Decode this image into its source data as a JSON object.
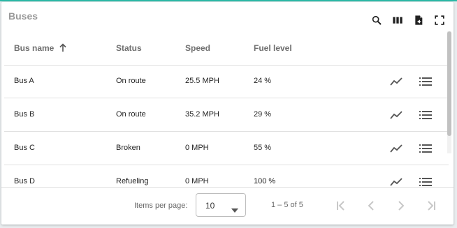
{
  "table": {
    "title": "Buses",
    "columns": {
      "bus_name": "Bus name",
      "status": "Status",
      "speed": "Speed",
      "fuel": "Fuel level"
    },
    "rows": [
      {
        "name": "Bus A",
        "status": "On route",
        "speed": "25.5 MPH",
        "fuel": "24 %"
      },
      {
        "name": "Bus B",
        "status": "On route",
        "speed": "35.2 MPH",
        "fuel": "29 %"
      },
      {
        "name": "Bus C",
        "status": "Broken",
        "speed": "0 MPH",
        "fuel": "55 %"
      },
      {
        "name": "Bus D",
        "status": "Refueling",
        "speed": "0 MPH",
        "fuel": "100 %"
      }
    ]
  },
  "toolbar": {
    "icons": [
      "search-icon",
      "columns-icon",
      "export-icon",
      "fullscreen-icon"
    ]
  },
  "pagination": {
    "items_per_page_label": "Items per page:",
    "items_per_page_value": "10",
    "range_label": "1 – 5 of 5"
  },
  "colors": {
    "accent_line": "#2bb8a6",
    "header_text": "#6f6f6f",
    "divider": "#e0e0e0"
  }
}
